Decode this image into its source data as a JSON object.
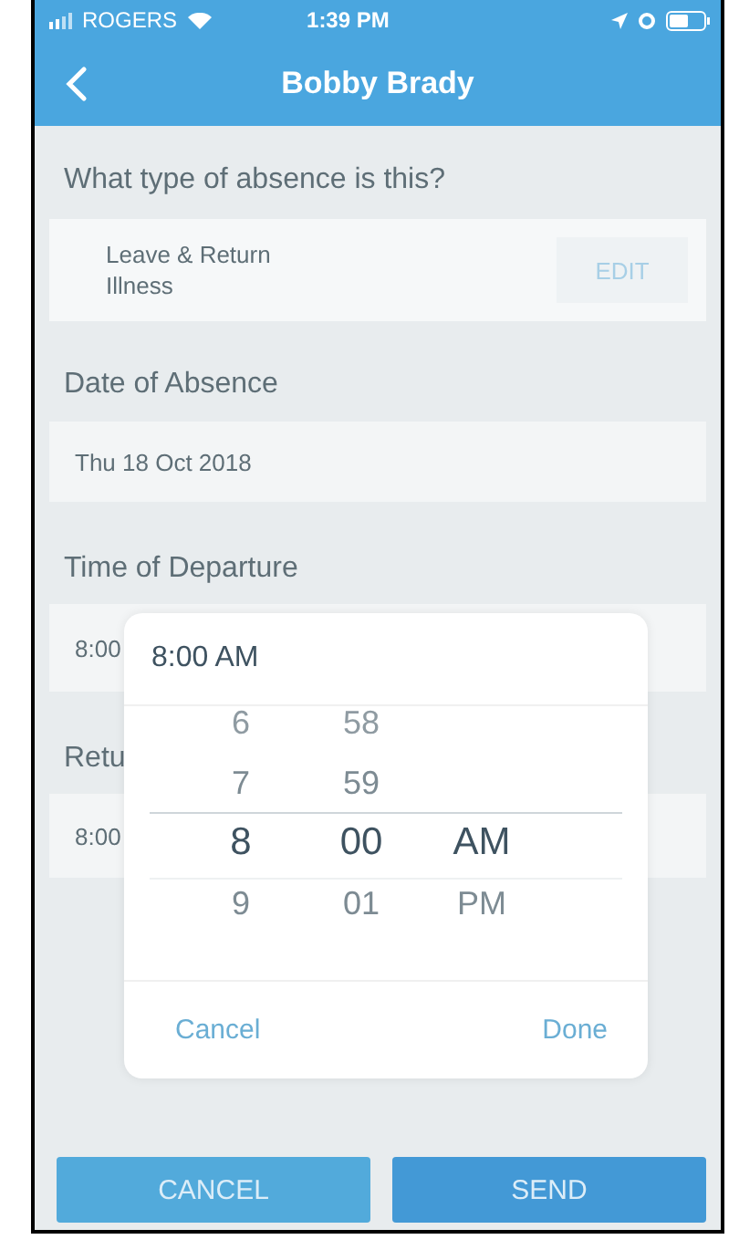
{
  "status_bar": {
    "carrier": "ROGERS",
    "time": "1:39 PM"
  },
  "nav": {
    "title": "Bobby Brady"
  },
  "absence_type": {
    "label": "What type of absence is this?",
    "line_1": "Leave & Return",
    "line_2": "Illness",
    "edit_button": "EDIT"
  },
  "date": {
    "label": "Date of Absence",
    "value": "Thu 18 Oct 2018"
  },
  "departure": {
    "label": "Time of Departure",
    "value": "8:00"
  },
  "return": {
    "label": "Retu",
    "value": "8:00"
  },
  "time_picker": {
    "value": "8:00 AM",
    "columns": [
      {
        "items": [
          {
            "text": "6",
            "selected": false
          },
          {
            "text": "7",
            "selected": false
          },
          {
            "text": "8",
            "selected": true
          },
          {
            "text": "9",
            "selected": false
          }
        ]
      },
      {
        "items": [
          {
            "text": "58",
            "selected": false
          },
          {
            "text": "59",
            "selected": false
          },
          {
            "text": "00",
            "selected": true
          },
          {
            "text": "01",
            "selected": false
          }
        ]
      },
      {
        "items": [
          {
            "text": "AM",
            "selected": true
          },
          {
            "text": "PM",
            "selected": false
          }
        ]
      }
    ],
    "cancel": "Cancel",
    "done": "Done"
  },
  "buttons": [
    {
      "label": "CANCEL",
      "kind": "secondary"
    },
    {
      "label": "SEND",
      "kind": "primary"
    }
  ]
}
